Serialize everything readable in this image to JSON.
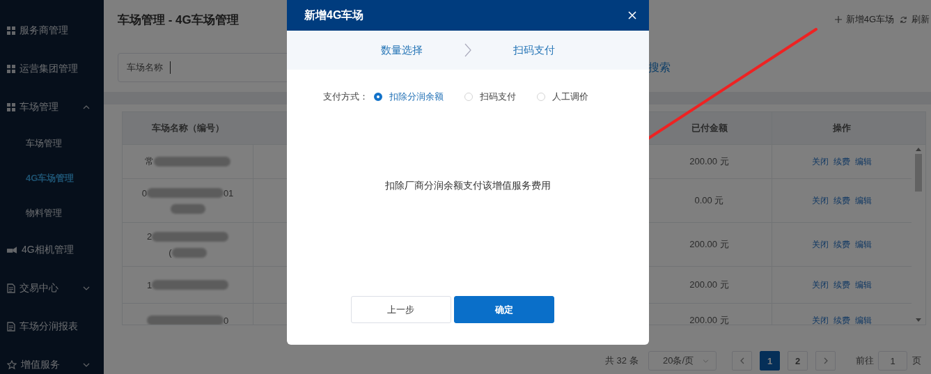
{
  "sidebar": {
    "items": [
      {
        "label": "服务商管理",
        "kind": "grid"
      },
      {
        "label": "运营集团管理",
        "kind": "grid"
      },
      {
        "label": "车场管理",
        "kind": "grid",
        "expanded": true,
        "children": [
          {
            "label": "车场管理",
            "selected": false
          },
          {
            "label": "4G车场管理",
            "selected": true
          },
          {
            "label": "物料管理",
            "selected": false
          }
        ]
      },
      {
        "label": "4G相机管理",
        "kind": "camera"
      },
      {
        "label": "交易中心",
        "kind": "document",
        "expanded": false
      },
      {
        "label": "车场分润报表",
        "kind": "document"
      },
      {
        "label": "增值服务",
        "kind": "star",
        "expanded": false
      }
    ]
  },
  "page": {
    "title": "车场管理 - 4G车场管理",
    "toolbar": [
      {
        "label": "新增4G车场",
        "kind": "add"
      },
      {
        "label": "刷新",
        "kind": "refresh"
      }
    ],
    "search": {
      "label": "车场名称",
      "button": "搜索"
    }
  },
  "table": {
    "columns": [
      "车场名称（编号）",
      "已付金额",
      "操作"
    ],
    "rows": [
      {
        "name_lines": [
          {
            "lead": "常",
            "redacted": true
          }
        ],
        "paid": "200.00 元",
        "actions": [
          "关闭",
          "续费",
          "编辑"
        ]
      },
      {
        "name_lines": [
          {
            "lead": "0",
            "redacted": true,
            "tail": "01"
          },
          {
            "redacted": true
          }
        ],
        "paid": "0.00 元",
        "actions": [
          "关闭",
          "续费",
          "编辑"
        ]
      },
      {
        "name_lines": [
          {
            "lead": "2",
            "redacted": true
          },
          {
            "lead": "(",
            "redacted": true
          }
        ],
        "paid": "200.00 元",
        "actions": [
          "关闭",
          "续费",
          "编辑"
        ]
      },
      {
        "name_lines": [
          {
            "lead": "1",
            "redacted": true
          }
        ],
        "paid": "200.00 元",
        "actions": [
          "关闭",
          "续费",
          "编辑"
        ]
      },
      {
        "name_lines": [
          {
            "redacted": true,
            "tail": "0"
          }
        ],
        "paid": "200.00 元",
        "actions": [
          "关闭",
          "续费",
          "编辑"
        ]
      }
    ]
  },
  "pagination": {
    "total": "共 32 条",
    "page_size": "20条/页",
    "pages": [
      {
        "label": "1",
        "selected": true
      },
      {
        "label": "2",
        "selected": false
      }
    ],
    "goto_label": "前往",
    "goto_value": "1",
    "goto_suffix": "页"
  },
  "modal": {
    "title": "新增4G车场",
    "steps": [
      "数量选择",
      "扫码支付"
    ],
    "payment_label": "支付方式：",
    "options": [
      {
        "label": "扣除分润余额",
        "selected": true
      },
      {
        "label": "扫码支付",
        "selected": false
      },
      {
        "label": "人工调价",
        "selected": false
      }
    ],
    "message": "扣除厂商分润余额支付该增值服务费用",
    "buttons": [
      {
        "label": "上一步",
        "kind": "secondary"
      },
      {
        "label": "确定",
        "kind": "primary"
      }
    ]
  }
}
